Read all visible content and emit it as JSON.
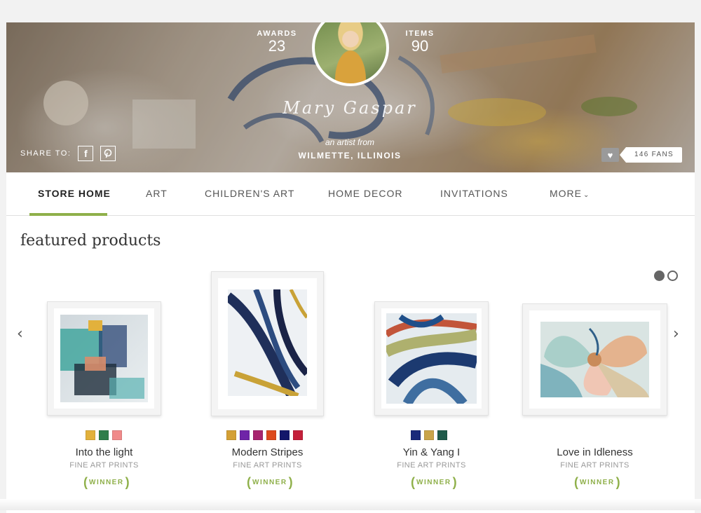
{
  "header": {
    "awards_label": "AWARDS",
    "awards_count": "23",
    "items_label": "ITEMS",
    "items_count": "90",
    "signature": "Mary Gaspar",
    "artist_from": "an artist from",
    "location": "WILMETTE, ILLINOIS",
    "share_label": "SHARE TO:",
    "fans": "146 FANS"
  },
  "nav": {
    "items": [
      {
        "label": "STORE HOME"
      },
      {
        "label": "ART"
      },
      {
        "label": "CHILDREN'S ART"
      },
      {
        "label": "HOME DECOR"
      },
      {
        "label": "INVITATIONS"
      },
      {
        "label": "MORE"
      }
    ]
  },
  "section_title": "featured products",
  "carousel": {
    "active_page": 1,
    "pages": 2
  },
  "products": [
    {
      "name": "Into the light",
      "category": "FINE ART PRINTS",
      "badge": "WINNER",
      "swatches": [
        "#e2b13c",
        "#2f7d4a",
        "#f08a8a"
      ]
    },
    {
      "name": "Modern Stripes",
      "category": "FINE ART PRINTS",
      "badge": "WINNER",
      "swatches": [
        "#d4a035",
        "#6f24a8",
        "#a8256e",
        "#dd4a1c",
        "#13176a",
        "#c4203a"
      ]
    },
    {
      "name": "Yin & Yang I",
      "category": "FINE ART PRINTS",
      "badge": "WINNER",
      "swatches": [
        "#1a2a7a",
        "#c9a44a",
        "#1f5a4a"
      ]
    },
    {
      "name": "Love in Idleness",
      "category": "FINE ART PRINTS",
      "badge": "WINNER",
      "swatches": []
    }
  ],
  "colors": {
    "accent": "#8fb04a",
    "text": "#333333",
    "muted": "#999999"
  },
  "icons": {
    "facebook": "facebook-icon",
    "pinterest": "pinterest-icon",
    "heart": "heart-icon",
    "prev": "chevron-left-icon",
    "next": "chevron-right-icon",
    "more": "chevron-down-icon"
  }
}
